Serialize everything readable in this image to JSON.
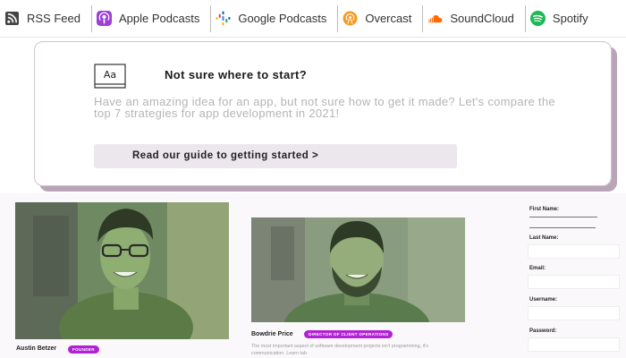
{
  "subscribe": {
    "items": [
      {
        "label": "RSS Feed",
        "icon": "rss-icon",
        "color": "#333333"
      },
      {
        "label": "Apple Podcasts",
        "icon": "apple-podcasts-icon",
        "color": "#9b3fd6"
      },
      {
        "label": "Google Podcasts",
        "icon": "google-podcasts-icon",
        "color": "#4285f4"
      },
      {
        "label": "Overcast",
        "icon": "overcast-icon",
        "color": "#f59a23"
      },
      {
        "label": "SoundCloud",
        "icon": "soundcloud-icon",
        "color": "#ff6a00"
      },
      {
        "label": "Spotify",
        "icon": "spotify-icon",
        "color": "#1db954"
      }
    ]
  },
  "cta": {
    "icon_text": "Aa",
    "title": "Not sure where to start?",
    "body": "Have an amazing idea for an app, but not sure how to get it made? Let's compare the top 7 strategies for app development in 2021!",
    "button_label": "Read our guide to getting started >"
  },
  "team": [
    {
      "name": "Austin Betzer",
      "role": "FOUNDER"
    },
    {
      "name": "Bowdrie Price",
      "role": "DIRECTOR OF CLIENT OPERATIONS",
      "description": "The most important aspect of software development projects isn't programming, it's communication. Learn tab"
    }
  ],
  "form": {
    "first_name": "First Name:",
    "last_name": "Last Name:",
    "email": "Email:",
    "username": "Username:",
    "password": "Password:"
  },
  "colors": {
    "accent": "#b122d4",
    "card_shadow": "#b9a5b7"
  }
}
